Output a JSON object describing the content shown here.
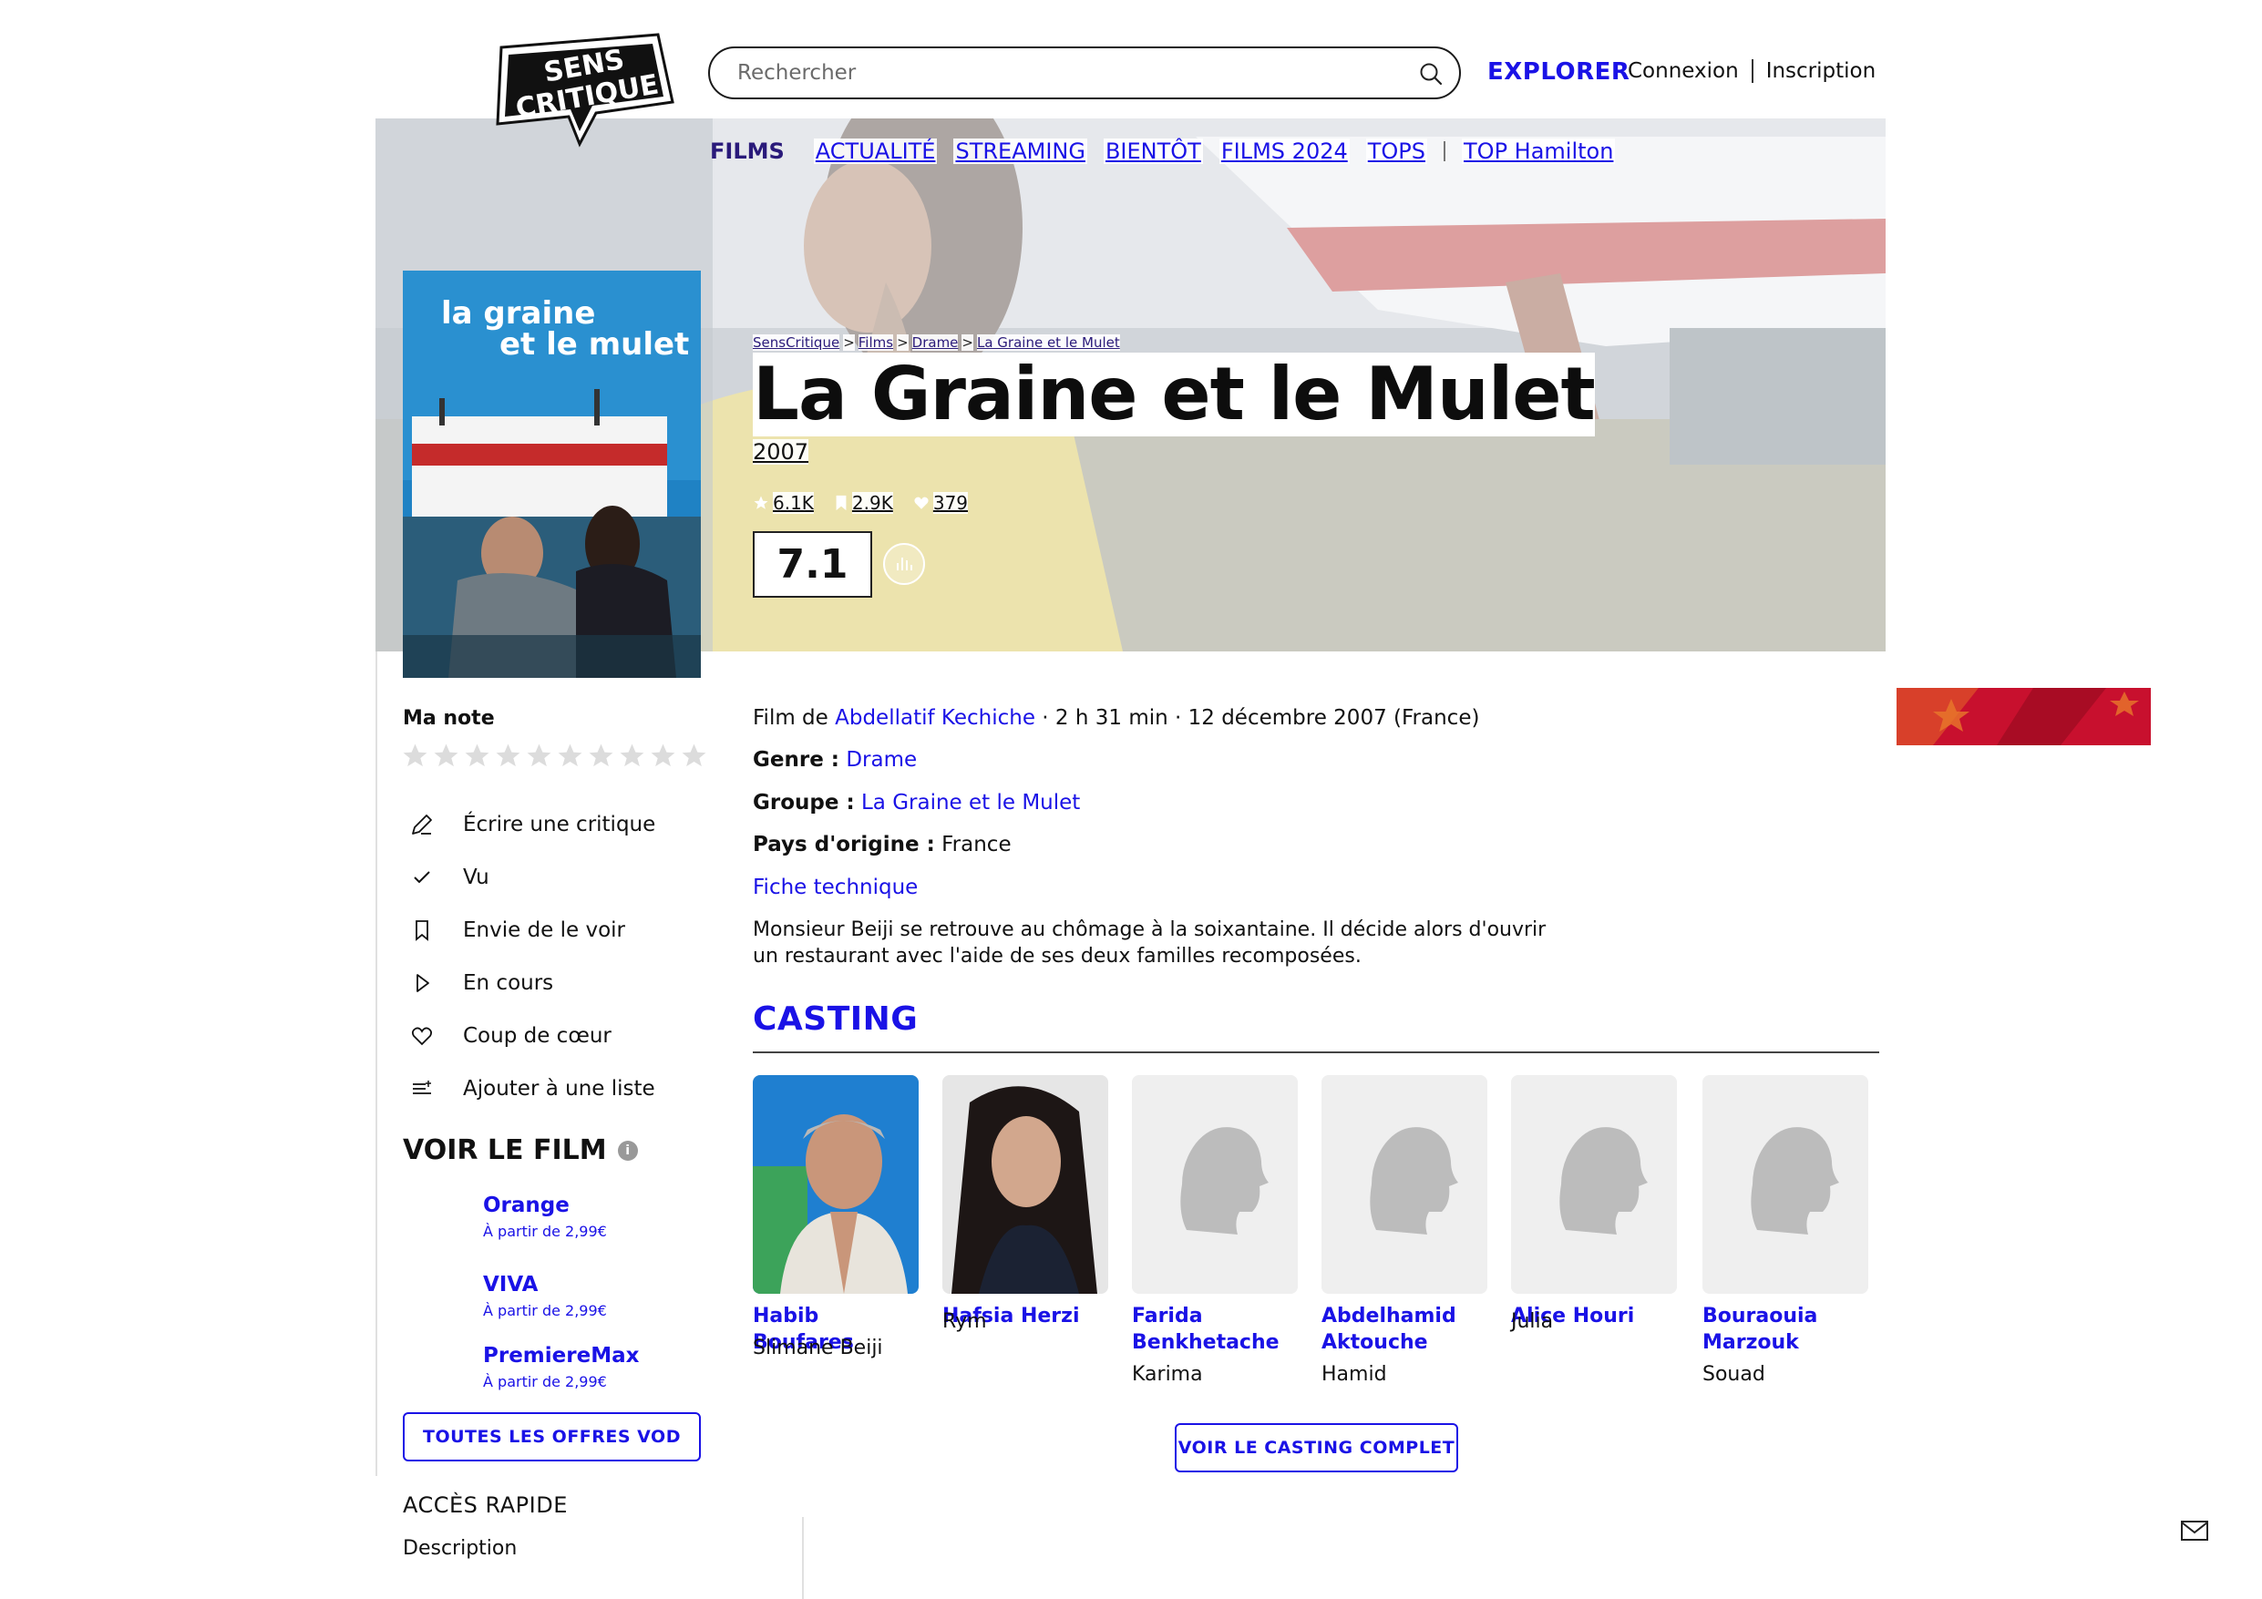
{
  "header": {
    "logo_line1": "SENS",
    "logo_line2": "CRITIQUE",
    "search_placeholder": "Rechercher",
    "explorer": "EXPLORER",
    "login": "Connexion",
    "signup": "Inscription"
  },
  "subnav": {
    "current": "FILMS",
    "items": [
      "ACTUALITÉ",
      "STREAMING",
      "BIENTÔT",
      "FILMS 2024",
      "TOPS"
    ],
    "extra": "TOP Hamilton"
  },
  "poster": {
    "line1": "la graine",
    "line2": "et le mulet"
  },
  "breadcrumb": [
    "SensCritique",
    "Films",
    "Drame",
    "La Graine et le Mulet"
  ],
  "breadcrumb_sep": ">",
  "movie": {
    "title": "La Graine et le Mulet",
    "year": "2007",
    "ratings_count": "6.1K",
    "wishlist_count": "2.9K",
    "favorites_count": "379",
    "score": "7.1",
    "meta_prefix": "Film de ",
    "director": "Abdellatif Kechiche",
    "meta_suffix": " · 2 h 31 min · 12 décembre 2007 (France)",
    "genre_label": "Genre :",
    "genre": "Drame",
    "group_label": "Groupe :",
    "group": "La Graine et le Mulet",
    "country_label": "Pays d'origine :",
    "country": "France",
    "tech_sheet": "Fiche technique",
    "synopsis": "Monsieur Beiji se retrouve au chômage à la soixantaine. Il décide alors d'ouvrir un restaurant avec l'aide de ses deux familles recomposées."
  },
  "sidebar": {
    "my_rating": "Ma note",
    "actions": [
      "Écrire une critique",
      "Vu",
      "Envie de le voir",
      "En cours",
      "Coup de cœur",
      "Ajouter à une liste"
    ],
    "watch_title": "VOIR LE FILM",
    "info": "i",
    "vod": [
      {
        "name": "Orange",
        "price": "À partir de 2,99€"
      },
      {
        "name": "VIVA",
        "price": "À partir de 2,99€"
      },
      {
        "name": "PremiereMax",
        "price": "À partir de 2,99€"
      }
    ],
    "all_vod": "TOUTES LES OFFRES VOD",
    "quick_access": "ACCÈS RAPIDE",
    "description": "Description"
  },
  "casting": {
    "title": "CASTING",
    "members": [
      {
        "line1": "Habib Boufares",
        "line2": "",
        "role": "Slimane Beiji"
      },
      {
        "line1": "Hafsia Herzi",
        "line2": "",
        "role": "Rym"
      },
      {
        "line1": "Farida",
        "line2": "Benkhetache",
        "role": "Karima"
      },
      {
        "line1": "Abdelhamid",
        "line2": "Aktouche",
        "role": "Hamid"
      },
      {
        "line1": "Alice Houri",
        "line2": "",
        "role": "Julia"
      },
      {
        "line1": "Bouraouia",
        "line2": "Marzouk",
        "role": "Souad"
      }
    ],
    "full_cast": "VOIR LE CASTING COMPLET"
  },
  "colors": {
    "accent": "#1a12e6",
    "dark_purple": "#2a1a7a",
    "text": "#111111"
  },
  "icons": [
    "search-icon",
    "star-icon",
    "bookmark-icon",
    "heart-icon",
    "chart-icon",
    "pencil-icon",
    "check-icon",
    "play-icon",
    "list-add-icon",
    "info-icon",
    "mail-icon",
    "silhouette-icon"
  ]
}
